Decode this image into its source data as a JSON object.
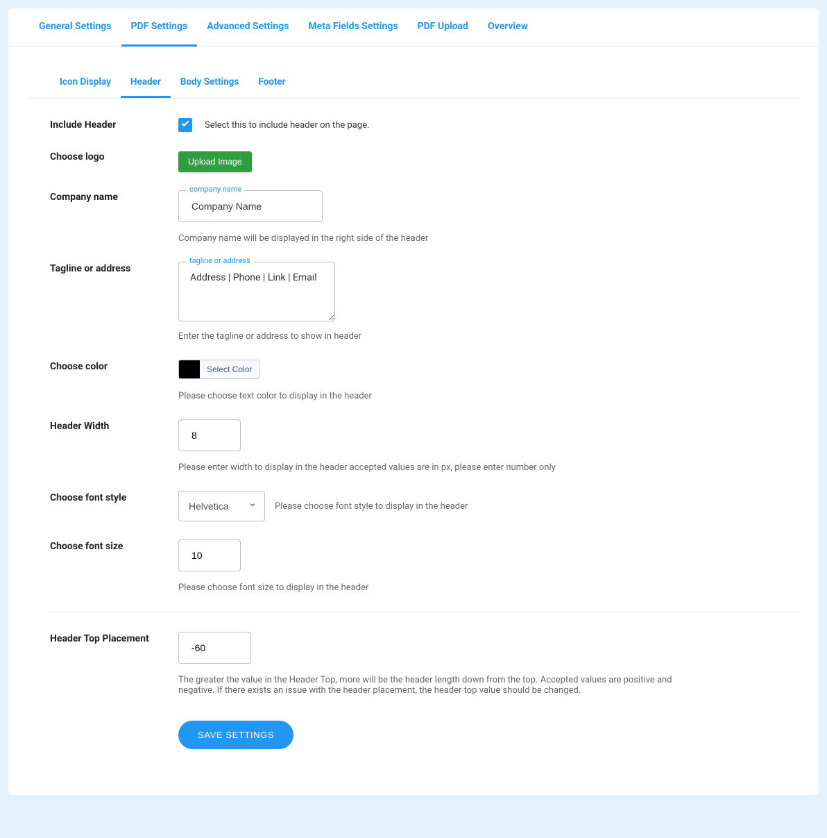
{
  "mainTabs": {
    "t0": "General Settings",
    "t1": "PDF Settings",
    "t2": "Advanced Settings",
    "t3": "Meta Fields Settings",
    "t4": "PDF Upload",
    "t5": "Overview"
  },
  "subTabs": {
    "s0": "Icon Display",
    "s1": "Header",
    "s2": "Body Settings",
    "s3": "Footer"
  },
  "labels": {
    "includeHeader": "Include Header",
    "chooseLogo": "Choose logo",
    "companyName": "Company name",
    "tagline": "Tagline or address",
    "chooseColor": "Choose color",
    "headerWidth": "Header Width",
    "fontStyle": "Choose font style",
    "fontSize": "Choose font size",
    "headerTop": "Header Top Placement"
  },
  "fields": {
    "checkboxText": "Select this to include header on the page.",
    "uploadBtn": "Upload Image",
    "companyFloat": "company name",
    "companyValue": "Company Name",
    "companyHelper": "Company name will be displayed in the right side of the header",
    "taglineFloat": "tagline or address",
    "taglineValue": "Address | Phone | Link | Email",
    "taglineHelper": "Enter the tagline or address to show in header",
    "colorBtn": "Select Color",
    "colorHelper": "Please choose text color to display in the header",
    "widthValue": "8",
    "widthHelper": "Please enter width to display in the header accepted values are in px, please enter number only",
    "fontStyleValue": "Helvetica",
    "fontStyleHelper": "Please choose font style to display in the header",
    "fontSizeValue": "10",
    "fontSizeHelper": "Please choose font size to display in the header",
    "headerTopValue": "-60",
    "headerTopHelper": "The greater the value in the Header Top, more will be the header length down from the top. Accepted values are positive and negative. If there exists an issue with the header placement, the header top value should be changed.",
    "saveBtn": "SAVE SETTINGS"
  },
  "colors": {
    "swatch": "#000000"
  }
}
